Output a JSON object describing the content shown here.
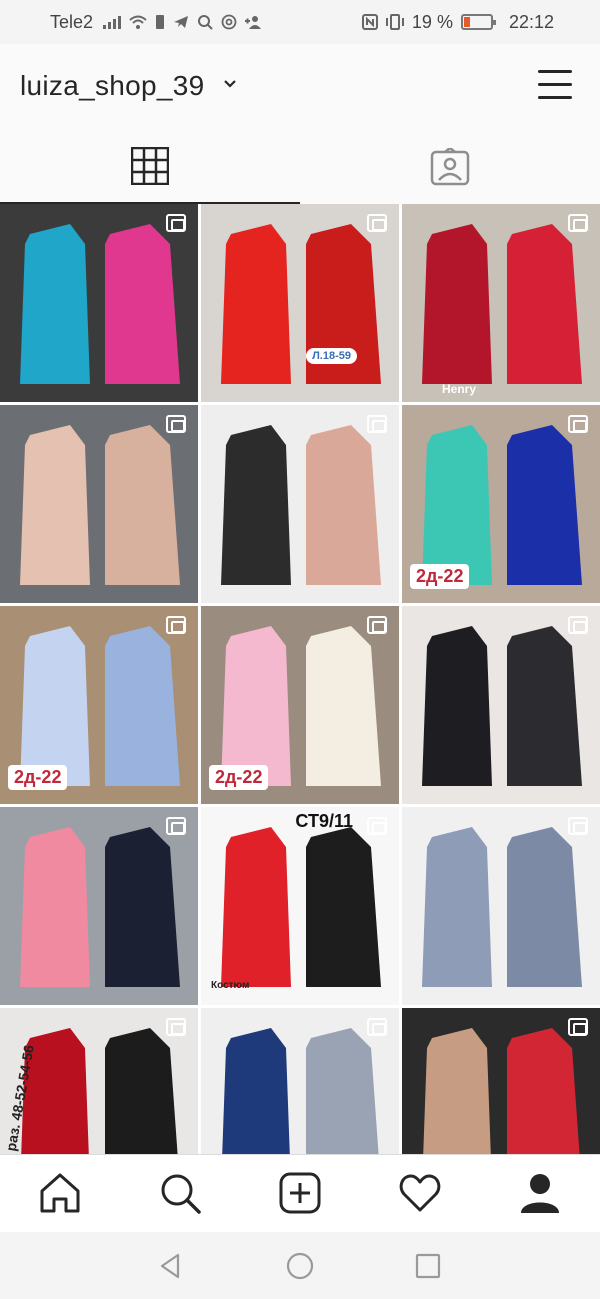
{
  "status_bar": {
    "carrier": "Tele2",
    "battery_percent": "19 %",
    "time": "22:12"
  },
  "header": {
    "username": "luiza_shop_39"
  },
  "tabs": [
    {
      "name": "grid",
      "active": true
    },
    {
      "name": "tagged",
      "active": false
    }
  ],
  "posts": [
    {
      "desc": "kids winter jumpsuits",
      "colors": [
        "#3b3b3b",
        "#1fa6c8",
        "#e0378f"
      ],
      "multi": true
    },
    {
      "desc": "red parka",
      "colors": [
        "#d8d4d0",
        "#e5231f",
        "#c81d1a"
      ],
      "multi": true,
      "tag": "Л.18-59"
    },
    {
      "desc": "reindeer sweater",
      "colors": [
        "#c7c1b8",
        "#b3152a",
        "#d62035"
      ],
      "multi": true,
      "tag": "Henry"
    },
    {
      "desc": "beige long coat",
      "colors": [
        "#6b6f73",
        "#e5c1b1",
        "#d8b09e"
      ],
      "multi": true
    },
    {
      "desc": "leather jackets with fur",
      "colors": [
        "#eeeeee",
        "#2c2c2c",
        "#d9a899"
      ],
      "multi": true
    },
    {
      "desc": "kids shirts",
      "colors": [
        "#b9a99a",
        "#3cc6b4",
        "#1a2fa8"
      ],
      "multi": true,
      "tag": "2д-22"
    },
    {
      "desc": "blue tulle dress",
      "colors": [
        "#a98f73",
        "#c3d3f0",
        "#9ab2de"
      ],
      "multi": true,
      "tag": "2д-22"
    },
    {
      "desc": "pink tulle dress",
      "colors": [
        "#9a8d80",
        "#f5b9cf",
        "#f3eee1"
      ],
      "multi": true,
      "tag": "2д-22"
    },
    {
      "desc": "black dress",
      "colors": [
        "#e9e6e3",
        "#1d1d22",
        "#2b2b30"
      ],
      "multi": true
    },
    {
      "desc": "pink kids jacket",
      "colors": [
        "#9aa0a6",
        "#f08aa1",
        "#1b2133"
      ],
      "multi": true
    },
    {
      "desc": "adidas red tracksuit",
      "colors": [
        "#f7f7f7",
        "#e0212a",
        "#1d1d1d"
      ],
      "multi": true,
      "tag": "СТ9/11",
      "caption": "Костюм"
    },
    {
      "desc": "grey knit sweater",
      "colors": [
        "#f0f0f0",
        "#8f9cb8",
        "#7d8aa6"
      ],
      "multi": true
    },
    {
      "desc": "red sweatshirt",
      "colors": [
        "#e9e7e6",
        "#b9101f",
        "#1c1c1c"
      ],
      "multi": true,
      "tag": "раз. 48-52-54-56"
    },
    {
      "desc": "navy sweatshirt",
      "colors": [
        "#efefef",
        "#1e3a7a",
        "#9aa3b4"
      ],
      "multi": true
    },
    {
      "desc": "beige puffer set",
      "colors": [
        "#2b2b2b",
        "#c69c82",
        "#d22635"
      ],
      "multi": true
    }
  ],
  "bottom_nav": [
    {
      "name": "home"
    },
    {
      "name": "search"
    },
    {
      "name": "new-post"
    },
    {
      "name": "activity"
    },
    {
      "name": "profile"
    }
  ],
  "android_nav": [
    {
      "name": "back"
    },
    {
      "name": "home"
    },
    {
      "name": "recents"
    }
  ]
}
